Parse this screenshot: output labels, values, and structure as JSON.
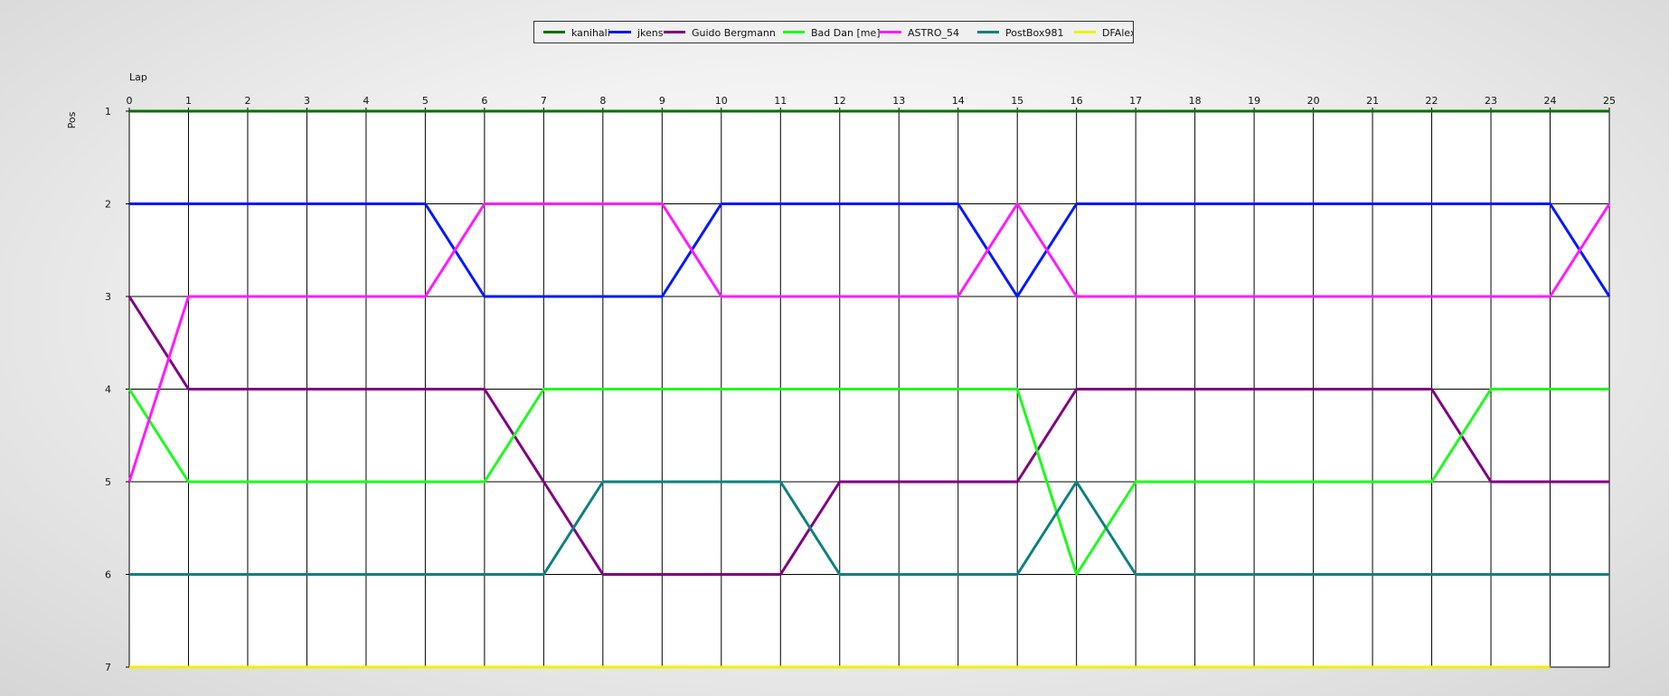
{
  "chart_data": {
    "type": "line",
    "xlabel": "Lap",
    "ylabel": "Pos",
    "xlim": [
      0,
      25
    ],
    "ylim": [
      1,
      7
    ],
    "y_inverted": true,
    "grid": true,
    "legend_position": "top-center",
    "x": [
      0,
      1,
      2,
      3,
      4,
      5,
      6,
      7,
      8,
      9,
      10,
      11,
      12,
      13,
      14,
      15,
      16,
      17,
      18,
      19,
      20,
      21,
      22,
      23,
      24,
      25
    ],
    "y_ticks": [
      1,
      2,
      3,
      4,
      5,
      6,
      7
    ],
    "series": [
      {
        "name": "kanihali",
        "color": "#007000",
        "values": [
          1,
          1,
          1,
          1,
          1,
          1,
          1,
          1,
          1,
          1,
          1,
          1,
          1,
          1,
          1,
          1,
          1,
          1,
          1,
          1,
          1,
          1,
          1,
          1,
          1,
          1
        ]
      },
      {
        "name": "jkens",
        "color": "#0018ff",
        "values": [
          2,
          2,
          2,
          2,
          2,
          2,
          3,
          3,
          3,
          3,
          2,
          2,
          2,
          2,
          2,
          3,
          2,
          2,
          2,
          2,
          2,
          2,
          2,
          2,
          2,
          3
        ]
      },
      {
        "name": "Guido Bergmann",
        "color": "#800080",
        "values": [
          3,
          4,
          4,
          4,
          4,
          4,
          4,
          5,
          6,
          6,
          6,
          6,
          5,
          5,
          5,
          5,
          4,
          4,
          4,
          4,
          4,
          4,
          4,
          5,
          5,
          5
        ]
      },
      {
        "name": "Bad Dan [me]",
        "color": "#1dfa1d",
        "values": [
          4,
          5,
          5,
          5,
          5,
          5,
          5,
          4,
          4,
          4,
          4,
          4,
          4,
          4,
          4,
          4,
          6,
          5,
          5,
          5,
          5,
          5,
          5,
          4,
          4,
          4
        ]
      },
      {
        "name": "ASTRO_54",
        "color": "#ff1aff",
        "values": [
          5,
          3,
          3,
          3,
          3,
          3,
          2,
          2,
          2,
          2,
          3,
          3,
          3,
          3,
          3,
          2,
          3,
          3,
          3,
          3,
          3,
          3,
          3,
          3,
          3,
          2
        ]
      },
      {
        "name": "PostBox981",
        "color": "#0f8080",
        "values": [
          6,
          6,
          6,
          6,
          6,
          6,
          6,
          6,
          5,
          5,
          5,
          5,
          6,
          6,
          6,
          6,
          5,
          6,
          6,
          6,
          6,
          6,
          6,
          6,
          6,
          6
        ]
      },
      {
        "name": "DFAlex",
        "color": "#f0f000",
        "values": [
          7,
          7,
          7,
          7,
          7,
          7,
          7,
          7,
          7,
          7,
          7,
          7,
          7,
          7,
          7,
          7,
          7,
          7,
          7,
          7,
          7,
          7,
          7,
          7,
          7,
          null
        ]
      }
    ]
  }
}
